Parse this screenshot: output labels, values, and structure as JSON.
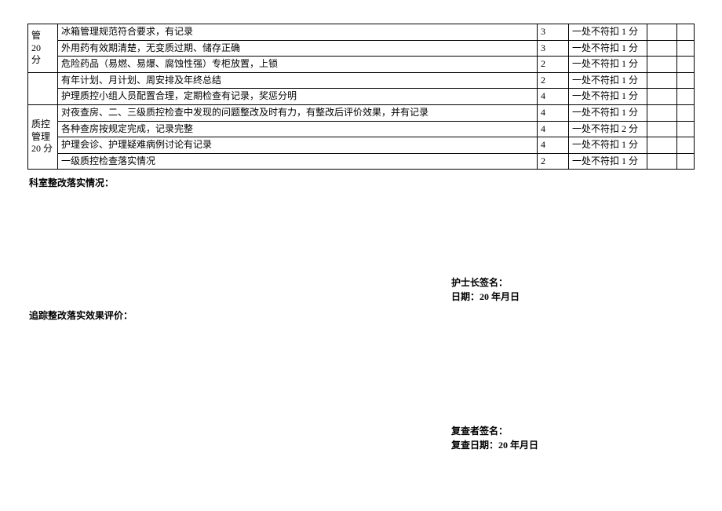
{
  "categories": {
    "guan": {
      "line1": "管",
      "line2": "20",
      "line3": "分"
    },
    "qc": {
      "line1": "质控",
      "line2": "管理",
      "line3": "20 分"
    }
  },
  "rows": [
    {
      "desc": "冰箱管理规范符合要求，有记录",
      "score": "3",
      "deduct": "一处不符扣 1 分"
    },
    {
      "desc": "外用药有效期清楚，无变质过期、储存正确",
      "score": "3",
      "deduct": "一处不符扣 1 分"
    },
    {
      "desc": "危险药品（易燃、易爆、腐蚀性强）专柜放置，上锁",
      "score": "2",
      "deduct": "一处不符扣 1 分"
    },
    {
      "desc": "有年计划、月计划、周安排及年终总结",
      "score": "2",
      "deduct": "一处不符扣 1 分"
    },
    {
      "desc": "护理质控小组人员配置合理，定期检查有记录，奖惩分明",
      "score": "4",
      "deduct": "一处不符扣 1 分"
    },
    {
      "desc": "对夜查房、二、三级质控检查中发现的问题整改及时有力，有整改后评价效果，并有记录",
      "score": "4",
      "deduct": "一处不符扣 1 分"
    },
    {
      "desc": "各种查房按规定完成，记录完整",
      "score": "4",
      "deduct": "一处不符扣 2 分"
    },
    {
      "desc": "护理会诊、护理疑难病例讨论有记录",
      "score": "4",
      "deduct": "一处不符扣 1 分"
    },
    {
      "desc": "一级质控检查落实情况",
      "score": "2",
      "deduct": "一处不符扣 1 分"
    }
  ],
  "labels": {
    "deptRect": "科室整改落实情况：",
    "trackEval": "追踪整改落实效果评价：",
    "nurseSign": "护士长签名：",
    "date1": "日期：20 年月日",
    "reviewerSign": "复查者签名：",
    "date2": "复查日期：20 年月日"
  }
}
